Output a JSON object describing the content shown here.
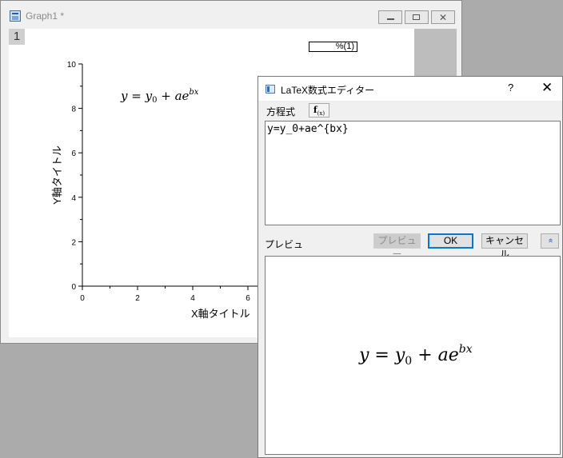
{
  "graph_window": {
    "title": "Graph1 *",
    "layer_number": "1",
    "legend_text": "%(1)",
    "formula": {
      "lhs": "y",
      "eq": " = ",
      "y": "y",
      "y_sub": "0",
      "plus": " + ",
      "a": "ae",
      "exp": "bx"
    },
    "colors": {
      "canvas": "#ffffff",
      "frame": "#f0f0f0",
      "strip": "#bdbdbd"
    }
  },
  "chart_data": {
    "type": "scatter",
    "x": [],
    "y": [],
    "xlabel": "X軸タイトル",
    "ylabel": "Y軸タイトル",
    "xlim": [
      0,
      10
    ],
    "ylim": [
      0,
      10
    ],
    "x_ticks": [
      "0",
      "2",
      "4",
      "6"
    ],
    "y_ticks": [
      "0",
      "2",
      "4",
      "6",
      "8",
      "10"
    ],
    "grid": false
  },
  "latex_dialog": {
    "title": "LaTeX数式エディター",
    "help": "?",
    "close": "✕",
    "equation_label": "方程式",
    "fx_label": "f",
    "fx_sub": "(x)",
    "equation_value": "y=y_0+ae^{bx}",
    "preview_label": "プレビュ",
    "buttons": {
      "preview": "プレビュー",
      "ok": "OK",
      "cancel": "キャンセル",
      "collapse": "«"
    },
    "preview_formula": {
      "lhs": "y",
      "eq": " = ",
      "y": "y",
      "y_sub": "0",
      "plus": " + ",
      "a": "ae",
      "exp": "bx"
    }
  }
}
